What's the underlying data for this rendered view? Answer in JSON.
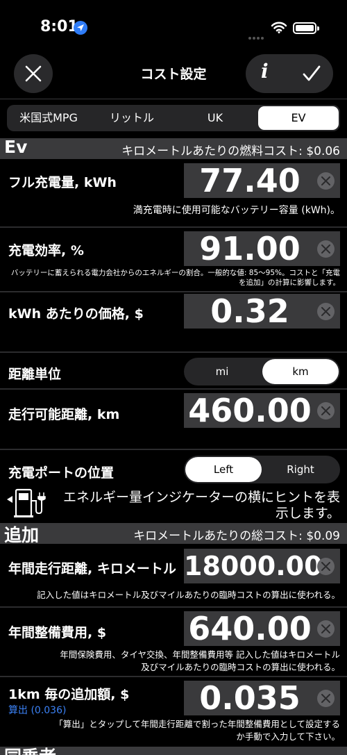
{
  "status": {
    "time": "8:01"
  },
  "nav": {
    "title": "コスト設定",
    "info_label": "i"
  },
  "units_tabs": [
    {
      "label": "米国式MPG",
      "selected": false
    },
    {
      "label": "リットル",
      "selected": false
    },
    {
      "label": "UK",
      "selected": false
    },
    {
      "label": "EV",
      "selected": true
    }
  ],
  "ev_section": {
    "title": "Ev",
    "fuel_cost": "キロメートルあたりの燃料コスト: $0.06",
    "full_charge": {
      "label": "フル充電量, kWh",
      "value": "77.40",
      "note": "満充電時に使用可能なバッテリー容量 (kWh)。"
    },
    "efficiency": {
      "label": "充電効率, %",
      "value": "91.00",
      "note_1": "バッテリーに蓄えられる電力会社からのエネルギーの割合。一般的な値: 85～95%。コストと「充電",
      "note_2": "を追加」の計算に影響します。"
    },
    "price": {
      "label": "kWh あたりの価格, $",
      "value": "0.32"
    },
    "distance_unit": {
      "label": "距離単位",
      "options": [
        "mi",
        "km"
      ],
      "selected": "km"
    },
    "range": {
      "label": "走行可能距離, km",
      "value": "460.00"
    },
    "charge_port": {
      "label": "充電ポートの位置",
      "options": [
        "Left",
        "Right"
      ],
      "selected": "Left"
    },
    "hint": "エネルギー量インジケーターの横にヒントを表示します。"
  },
  "extra_section": {
    "title": "追加",
    "total_cost": "キロメートルあたりの総コスト: $0.09",
    "annual_distance": {
      "label": "年間走行距離, キロメートル",
      "value": "18000.00",
      "note": "記入した値はキロメートル及びマイルあたりの臨時コストの算出に使われる。"
    },
    "maintenance": {
      "label": "年間整備費用, $",
      "value": "640.00",
      "note_1": "年間保険費用、タイヤ交換、年間整備費用等 記入した値はキロメートル",
      "note_2": "及びマイルあたりの臨時コストの算出に使われる。"
    },
    "per_km": {
      "label": "1km 毎の追加額, $",
      "value": "0.035",
      "calc_link": "算出 (0.036)",
      "note_1": "「算出」とタップして年間走行距離で割った年間整備費用として設定する",
      "note_2": "か手動で入力して下さい。"
    }
  },
  "next_section": {
    "title": "同乗者"
  },
  "colors": {
    "accent": "#3b82f6",
    "location": "#2f7cf6",
    "header_bg": "#3a3a3c",
    "field_bg": "#3a3a3c"
  }
}
